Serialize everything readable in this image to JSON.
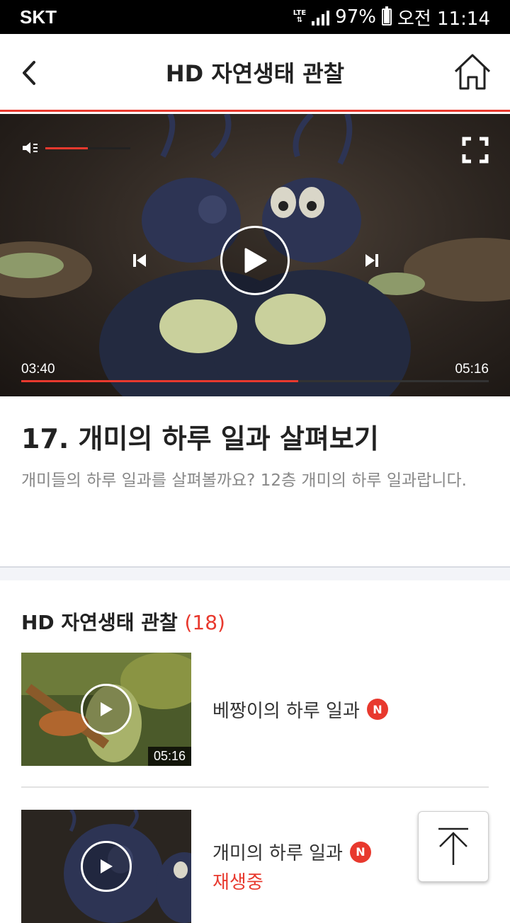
{
  "status_bar": {
    "carrier": "SKT",
    "network": "LTE",
    "battery": "97%",
    "time": "오전 11:14"
  },
  "header": {
    "title": "HD 자연생태 관찰",
    "back_icon": "chevron-left-icon",
    "home_icon": "home-icon"
  },
  "player": {
    "current_time": "03:40",
    "duration": "05:16",
    "progress_fraction": 0.593,
    "volume_fraction": 0.5,
    "accent_color": "#e8392e"
  },
  "episode": {
    "title": "17. 개미의 하루 일과 살펴보기",
    "description": "개미들의 하루 일과를 살펴볼까요? 12층 개미의 하루 일과랍니다."
  },
  "playlist": {
    "title": "HD 자연생태 관찰",
    "count": "(18)",
    "items": [
      {
        "name": "베짱이의 하루 일과",
        "badge": "N",
        "duration": "05:16",
        "status": ""
      },
      {
        "name": "개미의 하루 일과",
        "badge": "N",
        "duration": "",
        "status": "재생중"
      }
    ]
  }
}
